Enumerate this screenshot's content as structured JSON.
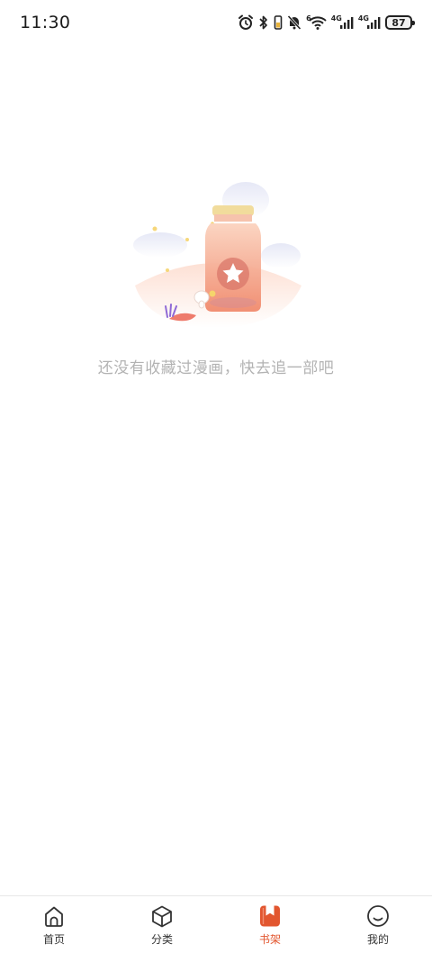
{
  "status_bar": {
    "time": "11:30",
    "icons": [
      "alarm-icon",
      "bluetooth-icon",
      "vibrate-icon",
      "mute-icon",
      "wifi-icon",
      "signal-icon",
      "signal-icon"
    ],
    "wifi_label": "6",
    "sim1_label": "4G",
    "sim2_label": "4G",
    "battery": "87"
  },
  "empty_state": {
    "message": "还没有收藏过漫画，快去追一部吧",
    "illustration": "star-jar-illustration"
  },
  "bottom_nav": {
    "active_color": "#e2562f",
    "items": [
      {
        "label": "首页",
        "icon": "home-icon",
        "active": false
      },
      {
        "label": "分类",
        "icon": "category-cube-icon",
        "active": false
      },
      {
        "label": "书架",
        "icon": "bookshelf-icon",
        "active": true
      },
      {
        "label": "我的",
        "icon": "profile-icon",
        "active": false
      }
    ]
  }
}
